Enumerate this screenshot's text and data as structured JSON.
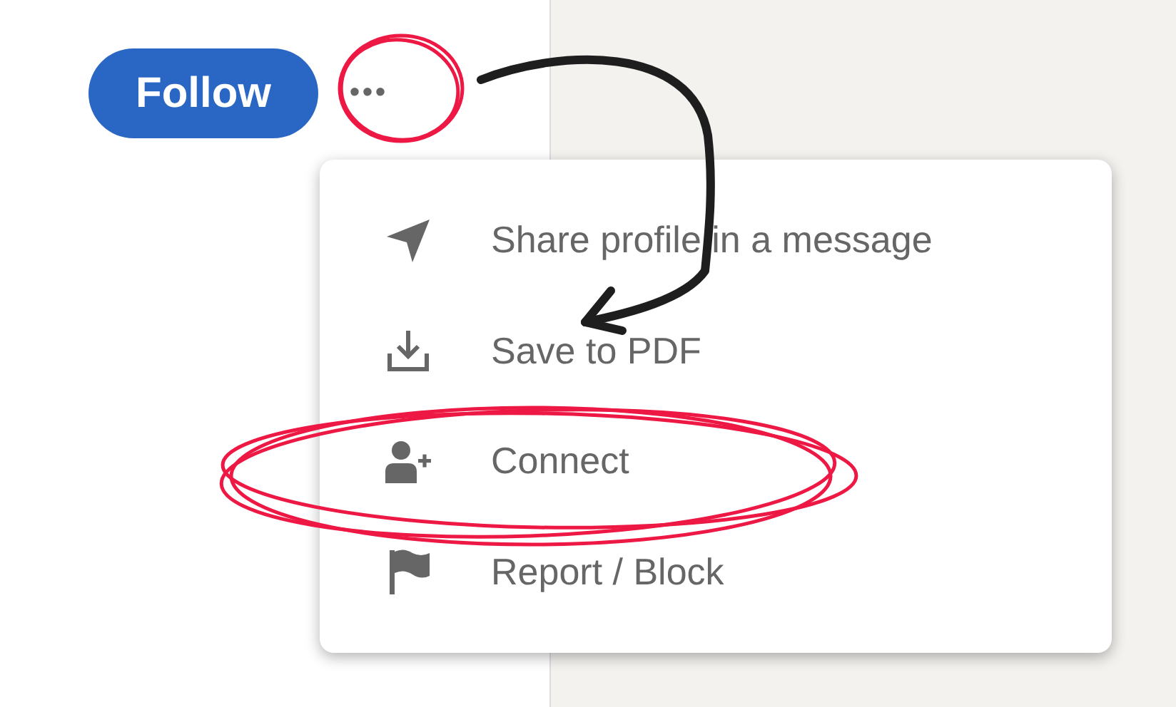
{
  "follow_button": {
    "label": "Follow"
  },
  "more_button": {
    "label": "•••"
  },
  "menu": {
    "items": [
      {
        "kind": "send",
        "label": "Share profile in a message"
      },
      {
        "kind": "download",
        "label": "Save to PDF"
      },
      {
        "kind": "add-person",
        "label": "Connect"
      },
      {
        "kind": "flag",
        "label": "Report / Block"
      }
    ]
  }
}
